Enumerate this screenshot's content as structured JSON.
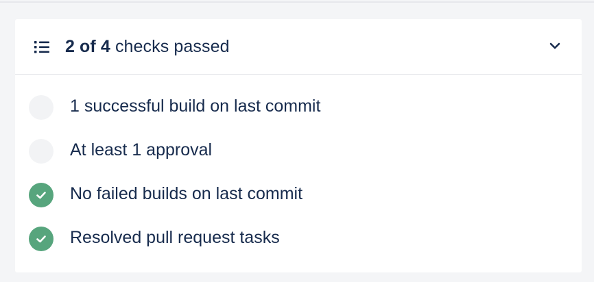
{
  "header": {
    "count_text": "2 of 4",
    "suffix_text": " checks passed",
    "list_icon": "list-icon",
    "chevron_icon": "chevron-down-icon"
  },
  "checks": [
    {
      "label": "1 successful build on last commit",
      "status": "pending"
    },
    {
      "label": "At least 1 approval",
      "status": "pending"
    },
    {
      "label": "No failed builds on last commit",
      "status": "passed"
    },
    {
      "label": "Resolved pull request tasks",
      "status": "passed"
    }
  ],
  "colors": {
    "passed": "#57a57d",
    "pending": "#f2f3f5",
    "text": "#172b4d"
  }
}
